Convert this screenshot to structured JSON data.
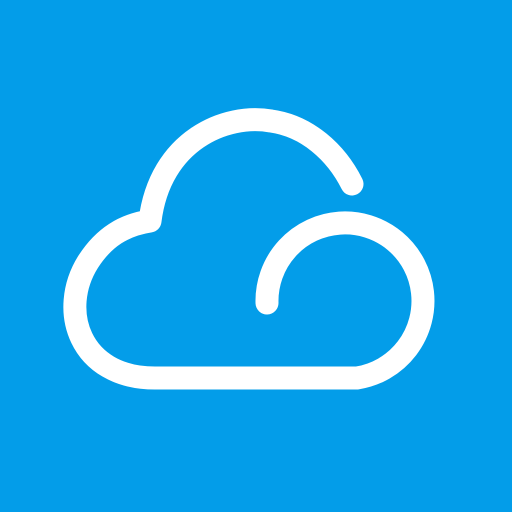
{
  "app_icon": {
    "icon": "cloud-icon",
    "background_color": "#039DE9",
    "glyph_color": "#FFFFFF"
  }
}
